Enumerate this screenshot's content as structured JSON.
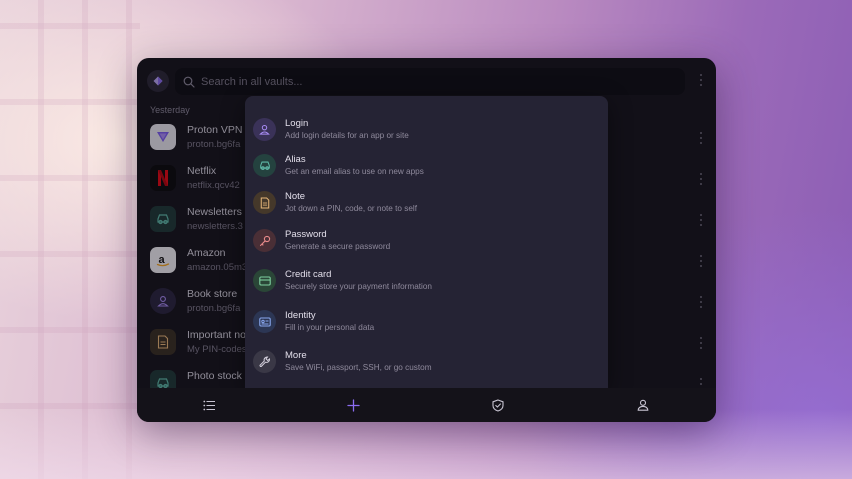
{
  "search": {
    "placeholder": "Search in all vaults..."
  },
  "list": {
    "section_label": "Yesterday",
    "items": [
      {
        "title": "Proton VPN",
        "subtitle": "proton.bg6fa",
        "icon": "proton-vpn-logo"
      },
      {
        "title": "Netflix",
        "subtitle": "netflix.qcv42",
        "icon": "netflix-logo"
      },
      {
        "title": "Newsletters",
        "subtitle": "newsletters.3",
        "icon": "alias-icon"
      },
      {
        "title": "Amazon",
        "subtitle": "amazon.05m3",
        "icon": "amazon-logo"
      },
      {
        "title": "Book store",
        "subtitle": "proton.bg6fa",
        "icon": "user-icon"
      },
      {
        "title": "Important no",
        "subtitle": "My PIN-codes",
        "icon": "note-icon"
      },
      {
        "title": "Photo stock",
        "subtitle": "",
        "icon": "alias-icon"
      }
    ]
  },
  "create_menu": {
    "options": [
      {
        "title": "Login",
        "description": "Add login details for an app or site",
        "icon": "user-icon",
        "color": "#a98cf5"
      },
      {
        "title": "Alias",
        "description": "Get an email alias to use on new apps",
        "icon": "alias-icon",
        "color": "#5fb9a8"
      },
      {
        "title": "Note",
        "description": "Jot down a PIN, code, or note to self",
        "icon": "note-icon",
        "color": "#e8b77a"
      },
      {
        "title": "Password",
        "description": "Generate a secure password",
        "icon": "key-icon",
        "color": "#e88a8a"
      },
      {
        "title": "Credit card",
        "description": "Securely store your payment information",
        "icon": "credit-card-icon",
        "color": "#7fd0a0"
      },
      {
        "title": "Identity",
        "description": "Fill in your personal data",
        "icon": "id-card-icon",
        "color": "#8aa8f0"
      },
      {
        "title": "More",
        "description": "Save WiFi, passport, SSH, or go custom",
        "icon": "wrench-icon",
        "color": "#d6d2de"
      }
    ]
  },
  "bottom_nav": [
    "list-icon",
    "plus-icon",
    "shield-icon",
    "account-icon"
  ],
  "colors": {
    "accent": "#8b6cf0",
    "app_bg": "#16141c",
    "menu_bg": "#252334"
  }
}
